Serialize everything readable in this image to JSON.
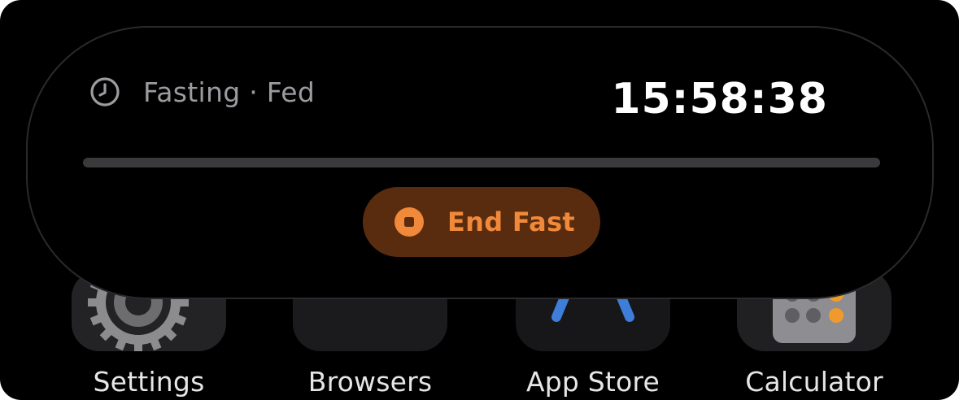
{
  "live_activity": {
    "status": "Fasting · Fed",
    "timer": "15:58:38",
    "progress": 0,
    "end_button_label": "End Fast",
    "icons": {
      "status": "clock-icon",
      "end_button": "stop-icon"
    },
    "colors": {
      "accent": "#f0893a",
      "button_bg": "#5a2c0f",
      "track": "#3a3a3c"
    }
  },
  "home_screen": {
    "apps": [
      {
        "label": "Settings",
        "icon": "gear-icon"
      },
      {
        "label": "Browsers",
        "icon": "folder-icon"
      },
      {
        "label": "App Store",
        "icon": "app-store-icon"
      },
      {
        "label": "Calculator",
        "icon": "calculator-icon"
      }
    ]
  }
}
